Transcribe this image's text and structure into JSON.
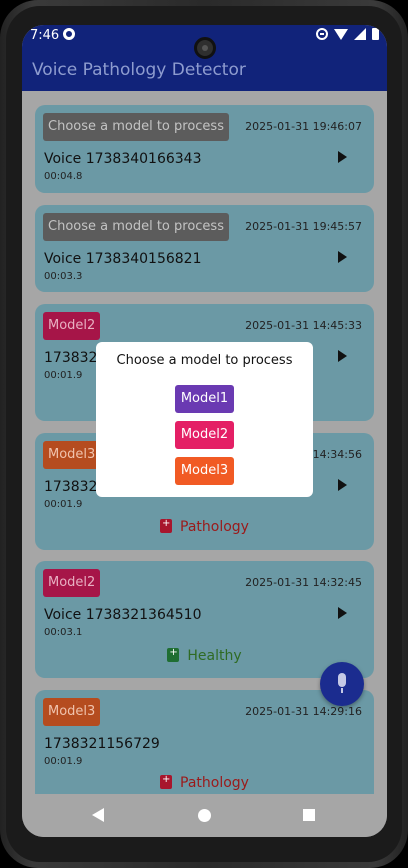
{
  "status": {
    "time": "7:46"
  },
  "app": {
    "title": "Voice Pathology Detector"
  },
  "recordings": [
    {
      "chip": "Choose a model to process",
      "date": "2025-01-31 19:46:07",
      "title": "Voice 1738340166343",
      "duration": "00:04.8",
      "result": ""
    },
    {
      "chip": "Choose a model to process",
      "date": "2025-01-31 19:45:57",
      "title": "Voice 1738340156821",
      "duration": "00:03.3",
      "result": ""
    },
    {
      "chip": "Model2",
      "date": "2025-01-31 14:45:33",
      "title": "1738321532946",
      "duration": "00:01.9",
      "result": ""
    },
    {
      "chip": "Model3",
      "date": "2025-01-31 14:34:56",
      "title": "1738321895961",
      "duration": "00:01.9",
      "result": "Pathology"
    },
    {
      "chip": "Model2",
      "date": "2025-01-31 14:32:45",
      "title": "Voice 1738321364510",
      "duration": "00:03.1",
      "result": "Healthy"
    },
    {
      "chip": "Model3",
      "date": "2025-01-31 14:29:16",
      "title": "1738321156729",
      "duration": "00:01.9",
      "result": "Pathology"
    }
  ],
  "dialog": {
    "title": "Choose a model to process",
    "options": [
      "Model1",
      "Model2",
      "Model3"
    ]
  },
  "colors": {
    "primary": "#11237a",
    "model1": "#6a3ab2",
    "model2": "#e41f65",
    "model3": "#f15a24"
  }
}
